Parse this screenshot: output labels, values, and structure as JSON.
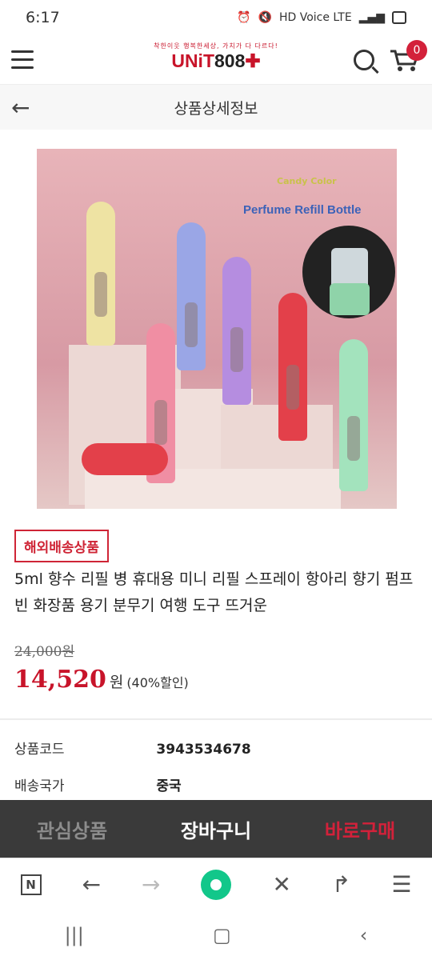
{
  "status_bar": {
    "time": "6:17",
    "icons_text": "HD Voice LTE"
  },
  "header": {
    "logo_tag": "착한이웃 행복한세상, 가치가 다 다르다!",
    "logo_main": "UNiT",
    "logo_num": "808",
    "cart_count": "0"
  },
  "subheader": {
    "title": "상품상세정보",
    "back_icon": "←"
  },
  "product_image": {
    "caption_small": "Candy Color",
    "caption_main": "Perfume Refill Bottle"
  },
  "product": {
    "badge": "해외배송상품",
    "title": "5ml 향수 리필 병 휴대용 미니 리필 스프레이 항아리 향기 펌프 빈 화장품 용기 분무기 여행 도구 뜨거운",
    "original_price": "24,000원",
    "sale_price": "14,520",
    "currency": "원",
    "discount": "(40%할인)"
  },
  "specs": [
    {
      "key": "상품코드",
      "value": "3943534678"
    },
    {
      "key": "배송국가",
      "value": "중국"
    }
  ],
  "action_bar": {
    "wishlist": "관심상품",
    "cart": "장바구니",
    "buy": "바로구매"
  },
  "browser_bar": {
    "n_label": "N"
  },
  "colors": {
    "brand": "#c8142a",
    "buy": "#d3213a",
    "bar_bg": "#3a3a3a"
  }
}
